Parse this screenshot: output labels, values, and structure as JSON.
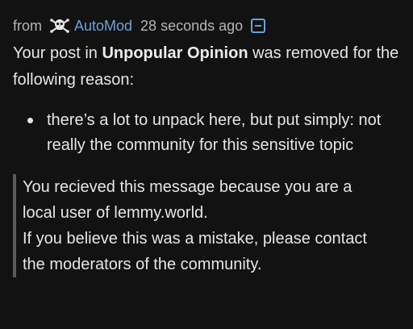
{
  "header": {
    "from_label": "from",
    "avatar_icon": "skull-crossbones-icon",
    "username": "AutoMod",
    "timestamp": "28 seconds ago",
    "collapse_icon": "collapse-minus-icon",
    "accent_color": "#6ea0d8"
  },
  "message": {
    "intro_before": "Your post in ",
    "community_name": "Unpopular Opinion",
    "intro_after": " was removed for the following reason:",
    "reasons": [
      "there’s a lot to unpack here, but put simply: not really the community for this sensitive topic"
    ],
    "quote_line_1": "You recieved this message because you are a local user of lemmy.world.",
    "quote_line_2": "If you believe this was a mistake, please contact the moderators of the community."
  }
}
